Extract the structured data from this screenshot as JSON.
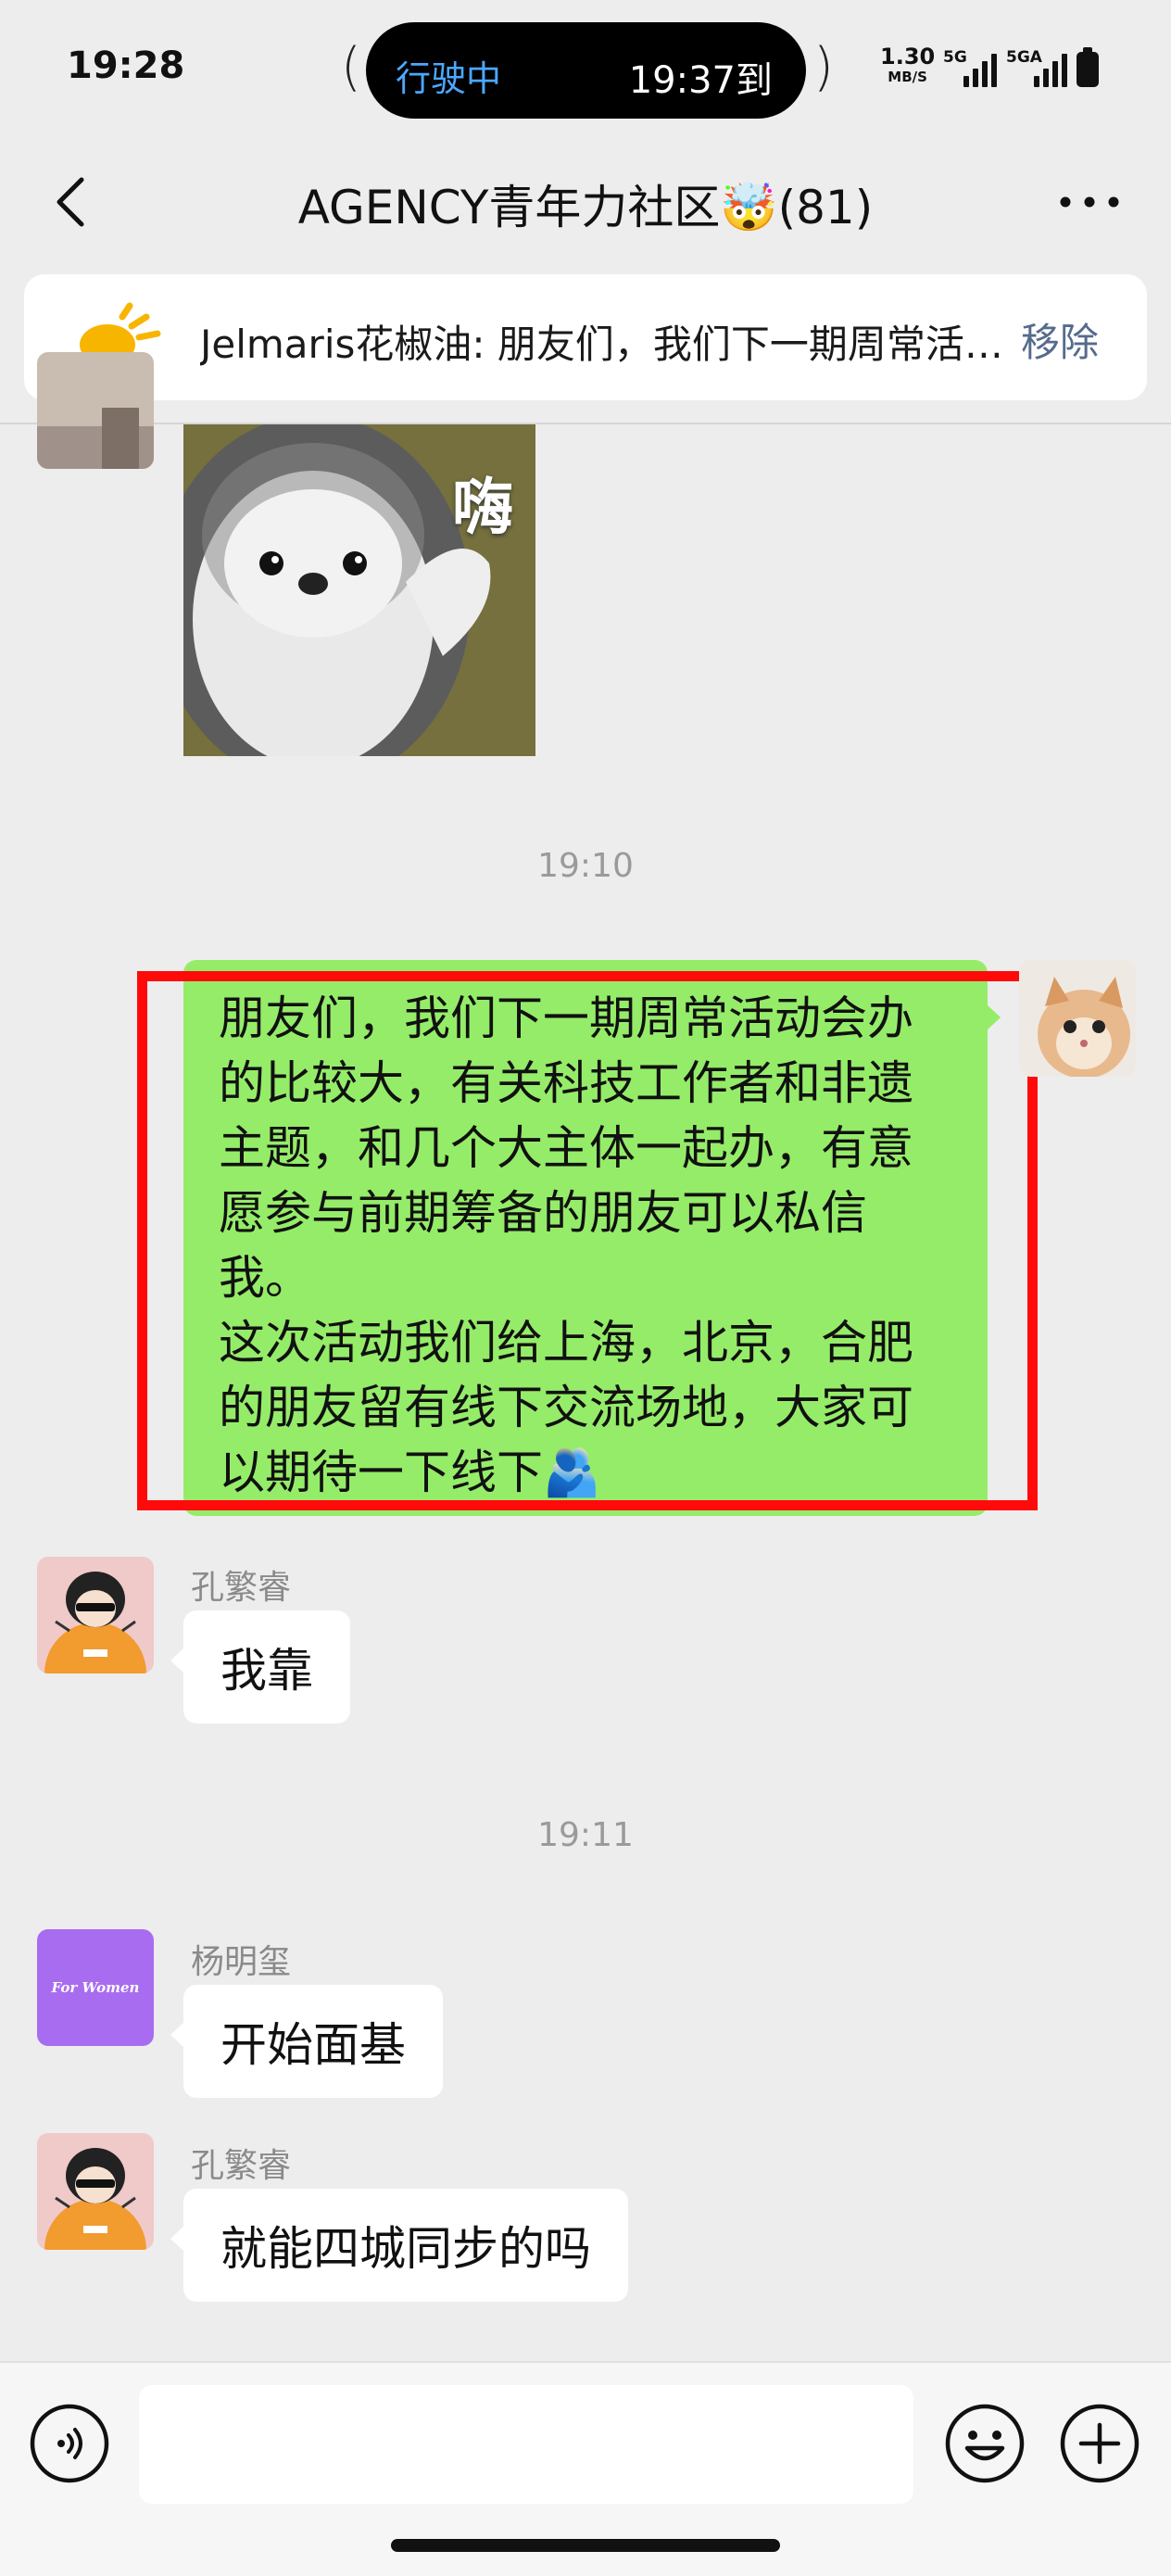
{
  "status_bar": {
    "time": "19:28",
    "island_left": "行驶中",
    "island_right": "19:37到",
    "paren_left": "(",
    "paren_right": ")",
    "net_speed": "1.30",
    "net_unit": "MB/S",
    "signal1": "5G",
    "signal2": "5GA"
  },
  "nav": {
    "title": "AGENCY青年力社区🤯(81)"
  },
  "notice": {
    "text": "Jelmaris花椒油: 朋友们，我们下一期周常活动会办的比较大，有关科技工作者和非遗主题",
    "remove_label": "移除"
  },
  "sticker_text": "嗨",
  "messages": {
    "ts1": "19:10",
    "own_text": "朋友们，我们下一期周常活动会办\n的比较大，有关科技工作者和非遗\n主题，和几个大主体一起办，有意\n愿参与前期筹备的朋友可以私信\n我。\n这次活动我们给上海，北京，合肥\n的朋友留有线下交流场地，大家可\n以期待一下线下🫂",
    "m2_sender": "孔繁睿",
    "m2_text": "我靠",
    "ts2": "19:11",
    "m3_sender": "杨明玺",
    "m3_avatar_text": "For Women",
    "m3_text": "开始面基",
    "m4_sender": "孔繁睿",
    "m4_text": "就能四城同步的吗"
  },
  "colors": {
    "own_bubble": "#95ec69",
    "highlight_box": "#ff0a0a",
    "island_text": "#4aa8ff",
    "remove_link": "#556b8d"
  }
}
